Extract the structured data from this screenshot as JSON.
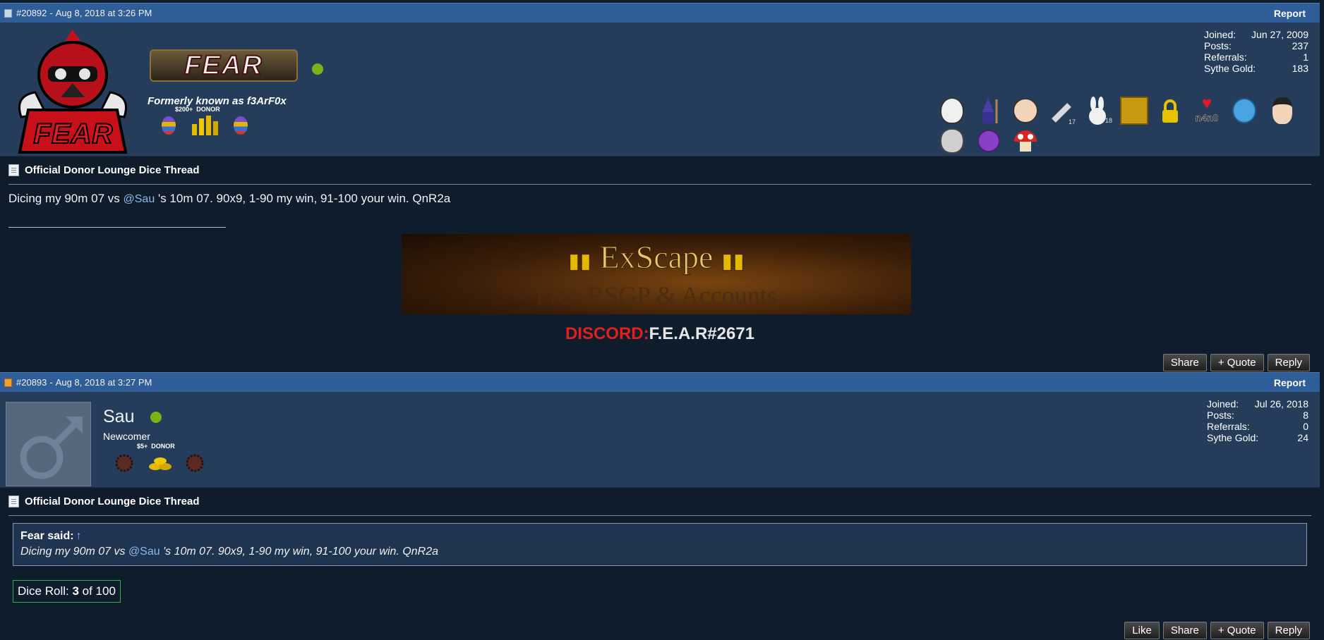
{
  "posts": [
    {
      "header": {
        "id": "#20892",
        "date": "Aug 8, 2018 at 3:26 PM",
        "separator": "-",
        "report": "Report"
      },
      "user": {
        "logo_text": "FEAR",
        "username_art": "FEAR",
        "subtitle": "Formerly known as f3ArF0x",
        "donor_tier": "$200+  DONOR",
        "stats": [
          {
            "label": "Joined:",
            "value": "Jun 27, 2009"
          },
          {
            "label": "Posts:",
            "value": "237"
          },
          {
            "label": "Referrals:",
            "value": "1"
          },
          {
            "label": "Sythe Gold:",
            "value": "183"
          }
        ],
        "award_number_a": "17",
        "award_number_b": "18",
        "award_text_c": "n4n0"
      },
      "thread_title": "Official Donor Lounge Dice Thread",
      "message": {
        "before": "Dicing my 90m 07 vs ",
        "mention": "@Sau",
        "after": " 's 10m 07. 90x9, 1-90 my win, 91-100 your win. QnR2a"
      },
      "signature": {
        "banner_title": "ExScape",
        "banner_subtitle": "Free RSGP & Accounts",
        "discord_label": "DISCORD:",
        "discord_value": "F.E.A.R#2671"
      },
      "actions": [
        "Share",
        "+ Quote",
        "Reply"
      ]
    },
    {
      "header": {
        "id": "#20893",
        "date": "Aug 8, 2018 at 3:27 PM",
        "separator": "-",
        "report": "Report"
      },
      "user": {
        "username": "Sau",
        "rank": "Newcomer",
        "donor_tier": "$5+  DONOR",
        "stats": [
          {
            "label": "Joined:",
            "value": "Jul 26, 2018"
          },
          {
            "label": "Posts:",
            "value": "8"
          },
          {
            "label": "Referrals:",
            "value": "0"
          },
          {
            "label": "Sythe Gold:",
            "value": "24"
          }
        ]
      },
      "thread_title": "Official Donor Lounge Dice Thread",
      "quote": {
        "author": "Fear said:",
        "arrow": "↑",
        "before": "Dicing my 90m 07 vs ",
        "mention": "@Sau",
        "after": " 's 10m 07. 90x9, 1-90 my win, 91-100 your win. QnR2a"
      },
      "dice": {
        "label": "Dice Roll: ",
        "value": "3",
        "suffix": " of 100"
      },
      "actions": [
        "Like",
        "Share",
        "+ Quote",
        "Reply"
      ]
    }
  ],
  "colors": {
    "header_bar": "#2e5d97",
    "user_panel": "#253d5b",
    "page_bg": "#0f1c2c",
    "online": "#7ab317",
    "discord_red": "#e0201f",
    "dice_border": "#2bb34a"
  }
}
